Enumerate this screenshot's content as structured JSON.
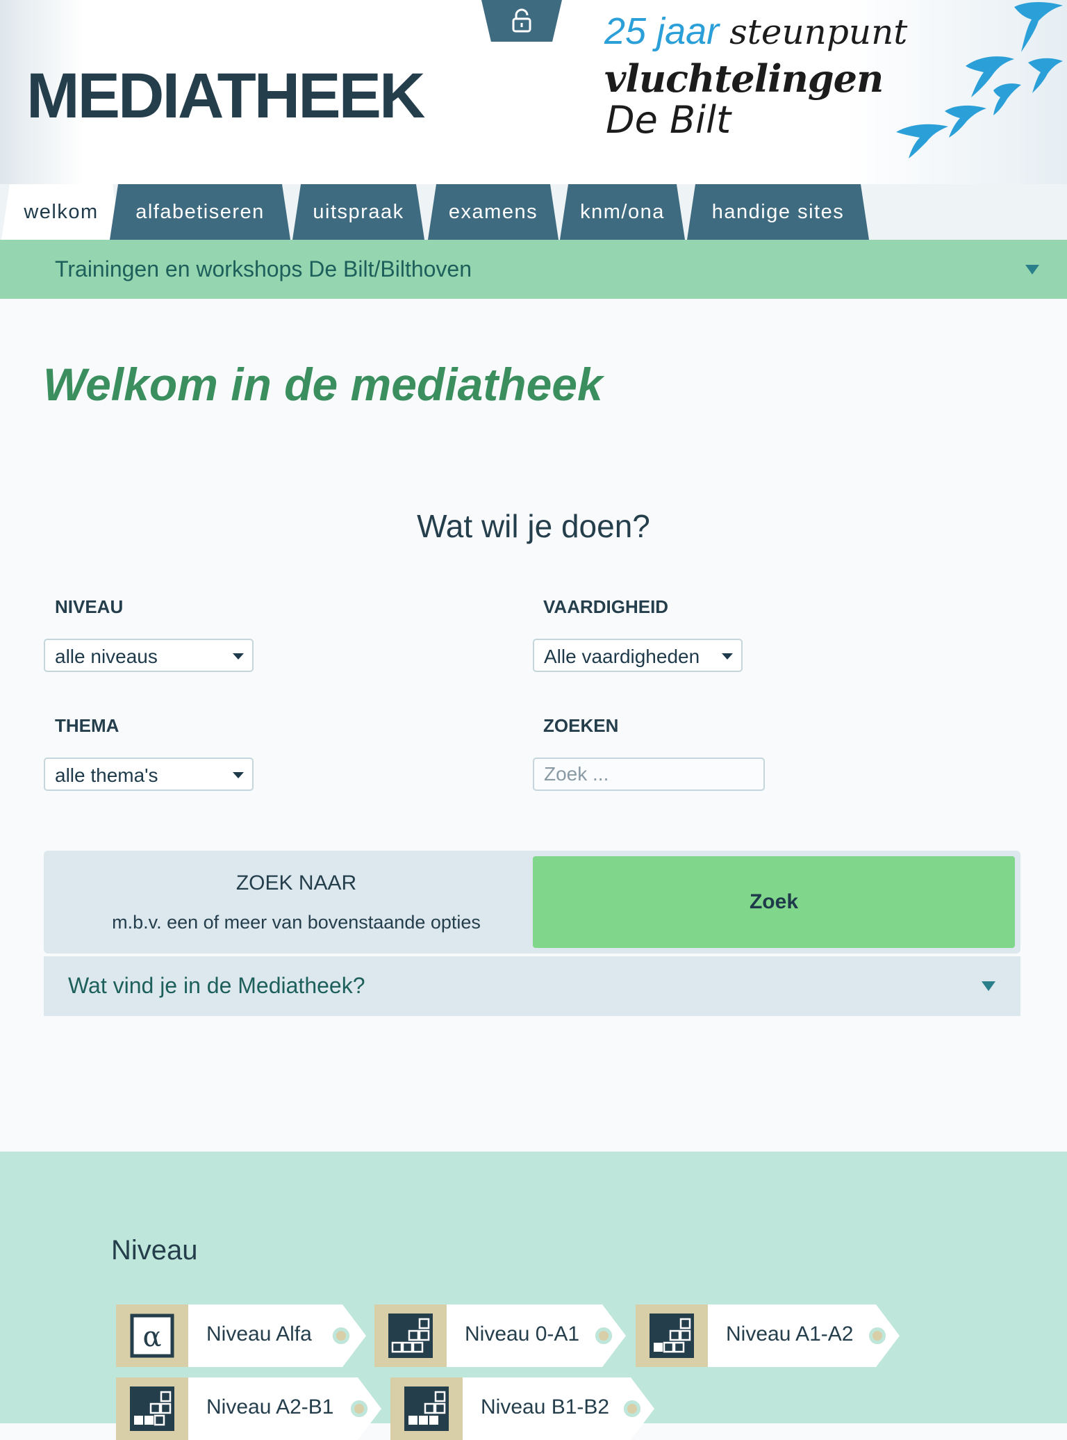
{
  "header": {
    "site_title": "MEDIATHEEK",
    "logo": {
      "line1_blue": "25 jaar",
      "line1_dark": "steunpunt",
      "line2": "vluchtelingen",
      "line3": "De Bilt",
      "brand_color": "#2a9fd8"
    },
    "lock_icon": "lock-icon"
  },
  "tabs": [
    {
      "label": "welkom",
      "active": true
    },
    {
      "label": "alfabetiseren",
      "active": false
    },
    {
      "label": "uitspraak",
      "active": false
    },
    {
      "label": "examens",
      "active": false
    },
    {
      "label": "knm/ona",
      "active": false
    },
    {
      "label": "handige sites",
      "active": false
    }
  ],
  "banner": {
    "label": "Trainingen en workshops De Bilt/Bilthoven"
  },
  "main": {
    "heading": "Welkom in de mediatheek",
    "subheading": "Wat wil je doen?",
    "filters": {
      "niveau": {
        "label": "NIVEAU",
        "value": "alle niveaus"
      },
      "vaardigheid": {
        "label": "VAARDIGHEID",
        "value": "Alle vaardigheden"
      },
      "thema": {
        "label": "THEMA",
        "value": "alle thema's"
      },
      "zoeken": {
        "label": "ZOEKEN",
        "placeholder": "Zoek ..."
      }
    },
    "search_panel": {
      "title": "ZOEK NAAR",
      "hint": "m.b.v. een of meer van bovenstaande opties",
      "button": "Zoek"
    },
    "accordion": {
      "label": "Wat vind je in de Mediatheek?"
    }
  },
  "levels": {
    "title": "Niveau",
    "items": [
      {
        "label": "Niveau Alfa",
        "icon": "alpha-icon"
      },
      {
        "label": "Niveau 0-A1",
        "icon": "level-blocks-icon"
      },
      {
        "label": "Niveau A1-A2",
        "icon": "level-blocks-icon"
      },
      {
        "label": "Niveau A2-B1",
        "icon": "level-blocks-icon"
      },
      {
        "label": "Niveau B1-B2",
        "icon": "level-blocks-icon"
      }
    ]
  },
  "colors": {
    "tab": "#3f6b80",
    "banner": "#95d5b0",
    "heading": "#3b8f5e",
    "search_button": "#80d68a",
    "levels_bg": "#bfe6da"
  }
}
